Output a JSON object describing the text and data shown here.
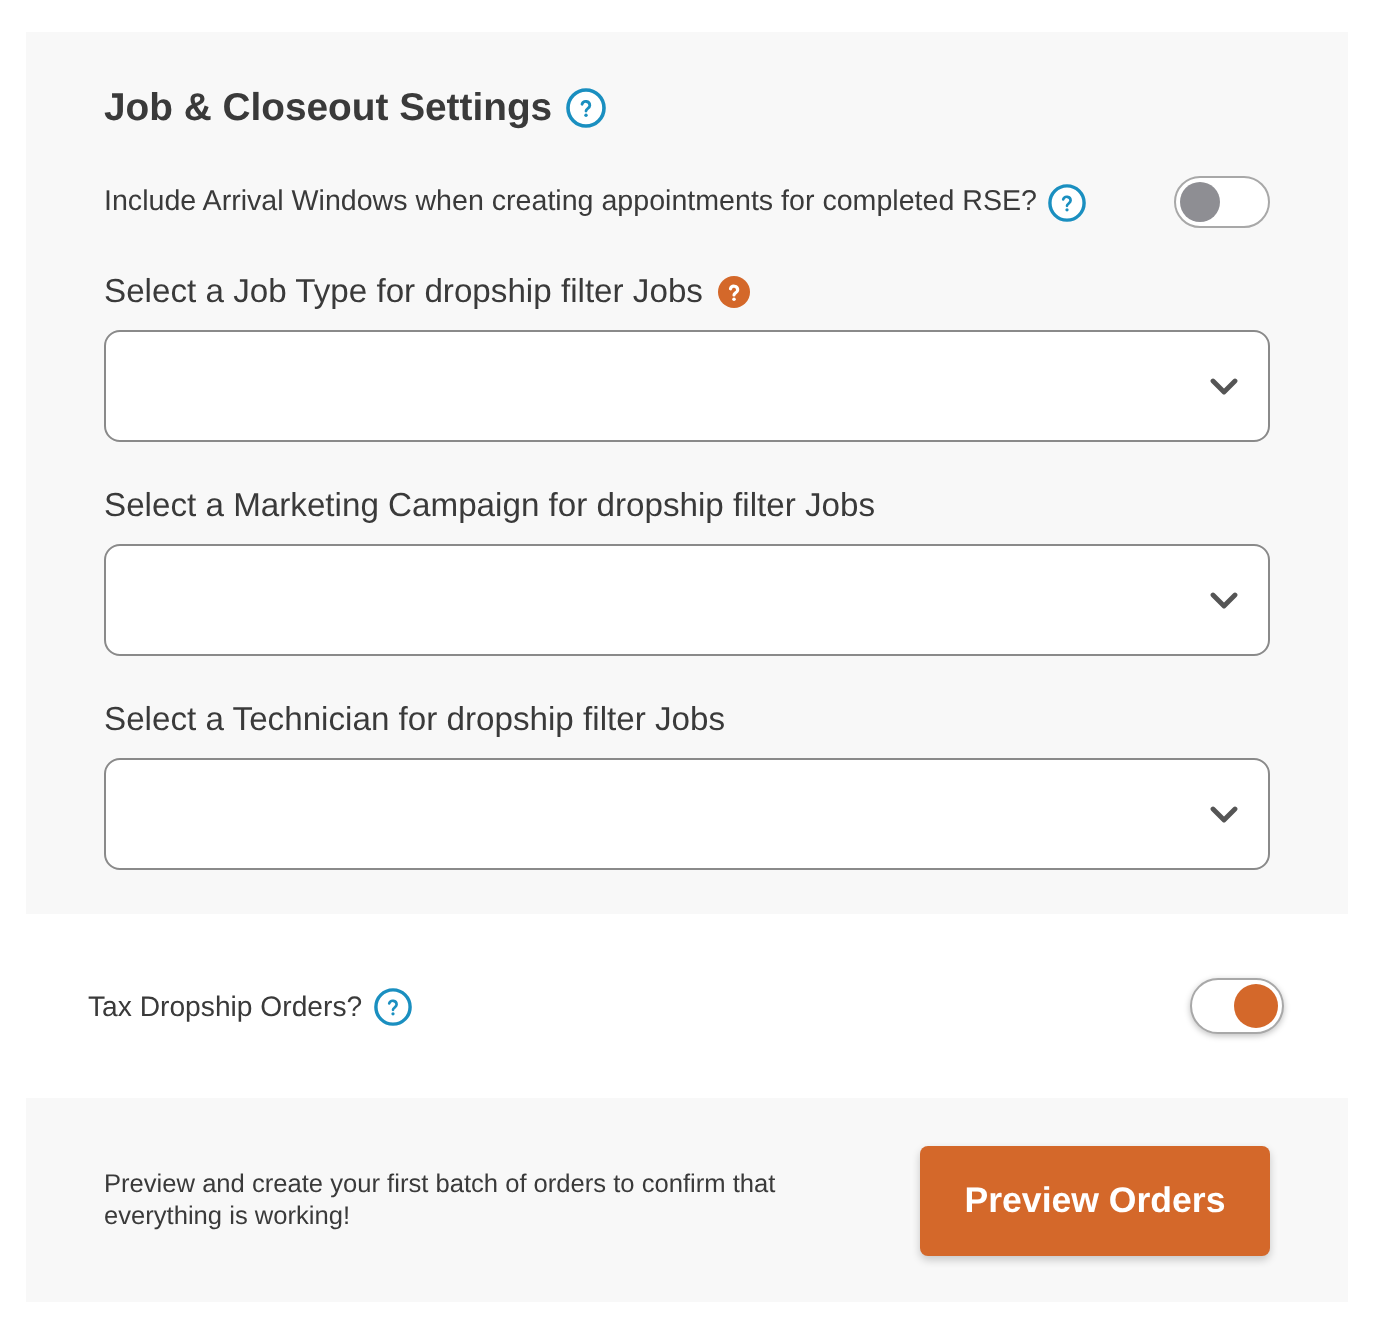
{
  "settings_panel": {
    "title": "Job & Closeout Settings",
    "title_help": {
      "kind": "outline"
    },
    "arrival_windows": {
      "label": "Include Arrival Windows when creating appointments for completed RSE?",
      "help": {
        "kind": "outline"
      },
      "on": false
    },
    "selects": [
      {
        "label": "Select a Job Type for dropship filter Jobs",
        "help": {
          "kind": "filled"
        }
      },
      {
        "label": "Select a Marketing Campaign for dropship filter Jobs"
      },
      {
        "label": "Select a Technician for dropship filter Jobs"
      }
    ]
  },
  "tax_row": {
    "label": "Tax Dropship Orders?",
    "help": {
      "kind": "outline"
    },
    "on": true
  },
  "footer": {
    "message": "Preview and create your first batch of orders to confirm that everything is working!",
    "button": "Preview Orders"
  }
}
